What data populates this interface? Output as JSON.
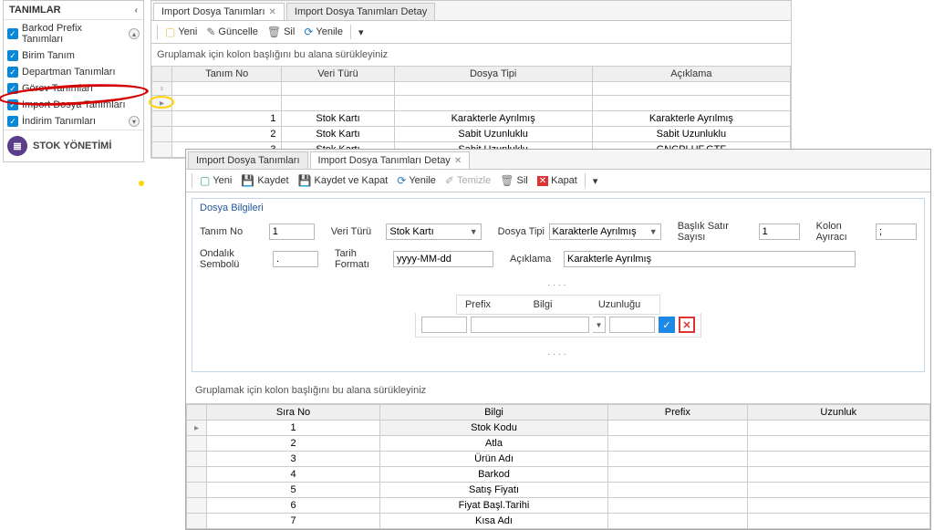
{
  "sidebar": {
    "title": "TANIMLAR",
    "items": [
      {
        "label": "Barkod Prefix Tanımları",
        "trail": "up"
      },
      {
        "label": "Birim Tanım"
      },
      {
        "label": "Departman Tanımları"
      },
      {
        "label": "Görev Tanımları"
      },
      {
        "label": "Import Dosya Tanımları"
      },
      {
        "label": "İndirim Tanımları",
        "trail": "down"
      }
    ],
    "stock_label": "STOK YÖNETİMİ"
  },
  "main": {
    "tabs": [
      {
        "label": "Import Dosya Tanımları",
        "active": true,
        "closable": true
      },
      {
        "label": "Import Dosya Tanımları Detay",
        "active": false,
        "closable": false
      }
    ],
    "toolbar": {
      "new_": "Yeni",
      "update": "Güncelle",
      "delete": "Sil",
      "refresh": "Yenile"
    },
    "group_hint": "Gruplamak için kolon başlığını bu alana sürükleyiniz",
    "columns": [
      "Tanım No",
      "Veri Türü",
      "Dosya Tipi",
      "Açıklama"
    ],
    "rows": [
      {
        "no": "1",
        "veri": "Stok Kartı",
        "tip": "Karakterle Ayrılmış",
        "acik": "Karakterle Ayrılmış"
      },
      {
        "no": "2",
        "veri": "Stok Kartı",
        "tip": "Sabit Uzunluklu",
        "acik": "Sabit Uzunluklu"
      },
      {
        "no": "3",
        "veri": "Stok Kartı",
        "tip": "Sabit Uzunluklu",
        "acik": "GNCPLUF.GTF"
      }
    ]
  },
  "detail": {
    "tabs": [
      {
        "label": "Import Dosya Tanımları",
        "active": false
      },
      {
        "label": "Import Dosya Tanımları Detay",
        "active": true,
        "closable": true
      }
    ],
    "toolbar": {
      "new_": "Yeni",
      "save": "Kaydet",
      "save_close": "Kaydet ve Kapat",
      "refresh": "Yenile",
      "clear": "Temizle",
      "delete": "Sil",
      "close": "Kapat"
    },
    "legend": "Dosya Bilgileri",
    "fields": {
      "tanim_no_lbl": "Tanım No",
      "tanim_no": "1",
      "veri_turu_lbl": "Veri Türü",
      "veri_turu": "Stok Kartı",
      "dosya_tipi_lbl": "Dosya Tipi",
      "dosya_tipi": "Karakterle Ayrılmış",
      "baslik_lbl": "Başlık Satır Sayısı",
      "baslik": "1",
      "kolon_lbl": "Kolon Ayıracı",
      "kolon": ";",
      "ondalik_lbl": "Ondalık Sembolü",
      "ondalik": ".",
      "tarih_lbl": "Tarih Formatı",
      "tarih": "yyyy-MM-dd",
      "aciklama_lbl": "Açıklama",
      "aciklama": "Karakterle Ayrılmış"
    },
    "prefix_box": {
      "prefix_lbl": "Prefix",
      "bilgi_lbl": "Bilgi",
      "uzun_lbl": "Uzunluğu"
    },
    "group_hint": "Gruplamak için kolon başlığını bu alana sürükleyiniz",
    "columns": [
      "Sıra No",
      "Bilgi",
      "Prefix",
      "Uzunluk"
    ],
    "rows": [
      {
        "no": "1",
        "bilgi": "Stok Kodu"
      },
      {
        "no": "2",
        "bilgi": "Atla"
      },
      {
        "no": "3",
        "bilgi": "Ürün Adı"
      },
      {
        "no": "4",
        "bilgi": "Barkod"
      },
      {
        "no": "5",
        "bilgi": "Satış Fiyatı"
      },
      {
        "no": "6",
        "bilgi": "Fiyat Başl.Tarihi"
      },
      {
        "no": "7",
        "bilgi": "Kısa Adı"
      }
    ]
  }
}
